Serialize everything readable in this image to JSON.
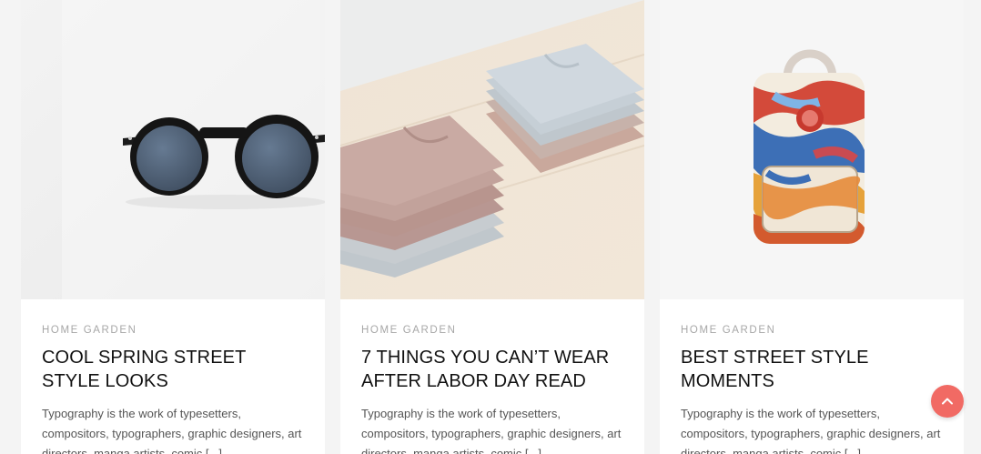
{
  "posts": [
    {
      "category": "HOME GARDEN",
      "title": "COOL SPRING STREET STYLE LOOKS",
      "excerpt": "Typography is the work of typesetters, compositors, typographers, graphic designers, art directors, manga artists, comic [...]",
      "image_icon": "sunglasses-image"
    },
    {
      "category": "HOME GARDEN",
      "title": "7 THINGS YOU CAN’T WEAR AFTER LABOR DAY READ",
      "excerpt": "Typography is the work of typesetters, compositors, typographers, graphic designers, art directors, manga artists, comic [...]",
      "image_icon": "folded-tshirts-image"
    },
    {
      "category": "HOME GARDEN",
      "title": "BEST STREET STYLE MOMENTS",
      "excerpt": "Typography is the work of typesetters, compositors, typographers, graphic designers, art directors, manga artists, comic [...]",
      "image_icon": "backpack-image"
    }
  ],
  "scroll_top": {
    "icon": "chevron-up-icon"
  },
  "colors": {
    "accent": "#f16a64",
    "category": "#a7a7a7",
    "title": "#111111",
    "excerpt": "#555555"
  }
}
